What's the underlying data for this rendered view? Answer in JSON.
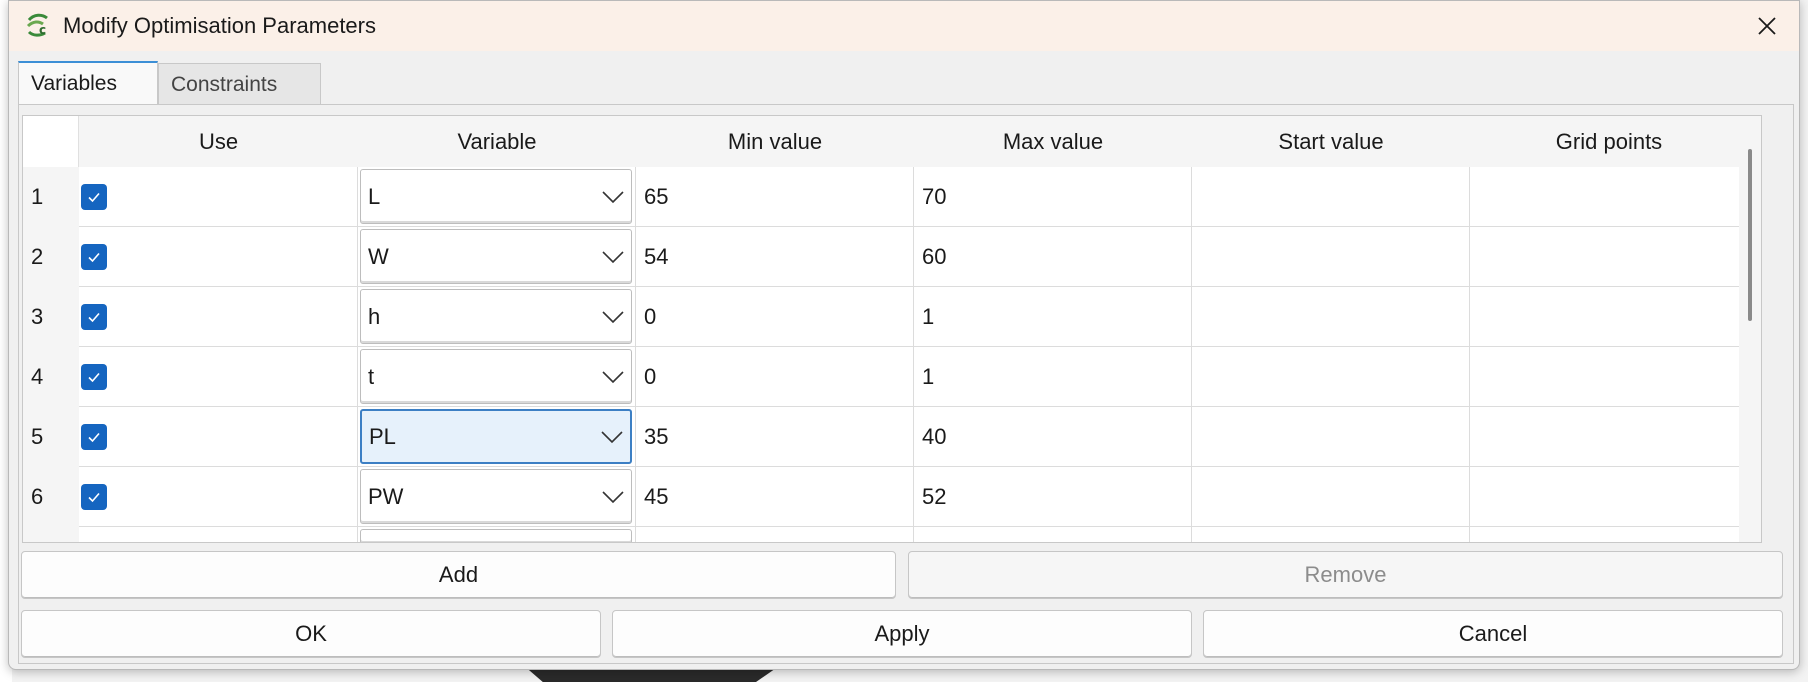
{
  "dialog": {
    "title": "Modify Optimisation Parameters",
    "close_icon": "close-icon",
    "app_icon": "freecad-logo-icon"
  },
  "tabs": [
    {
      "label": "Variables",
      "active": true
    },
    {
      "label": "Constraints",
      "active": false
    }
  ],
  "table": {
    "headers": [
      "Use",
      "Variable",
      "Min value",
      "Max value",
      "Start value",
      "Grid points"
    ],
    "rows": [
      {
        "num": "1",
        "use": true,
        "variable": "L",
        "min": "65",
        "max": "70",
        "start": "",
        "grid": ""
      },
      {
        "num": "2",
        "use": true,
        "variable": "W",
        "min": "54",
        "max": "60",
        "start": "",
        "grid": ""
      },
      {
        "num": "3",
        "use": true,
        "variable": "h",
        "min": "0",
        "max": "1",
        "start": "",
        "grid": ""
      },
      {
        "num": "4",
        "use": true,
        "variable": "t",
        "min": "0",
        "max": "1",
        "start": "",
        "grid": ""
      },
      {
        "num": "5",
        "use": true,
        "variable": "PL",
        "min": "35",
        "max": "40",
        "start": "",
        "grid": "",
        "focused": true
      },
      {
        "num": "6",
        "use": true,
        "variable": "PW",
        "min": "45",
        "max": "52",
        "start": "",
        "grid": ""
      }
    ]
  },
  "buttons": {
    "add": "Add",
    "remove": "Remove",
    "ok": "OK",
    "apply": "Apply",
    "cancel": "Cancel"
  },
  "colors": {
    "accent": "#1565c0",
    "titlebar": "#fbf0e8",
    "focus_border": "#3c7fc4"
  }
}
